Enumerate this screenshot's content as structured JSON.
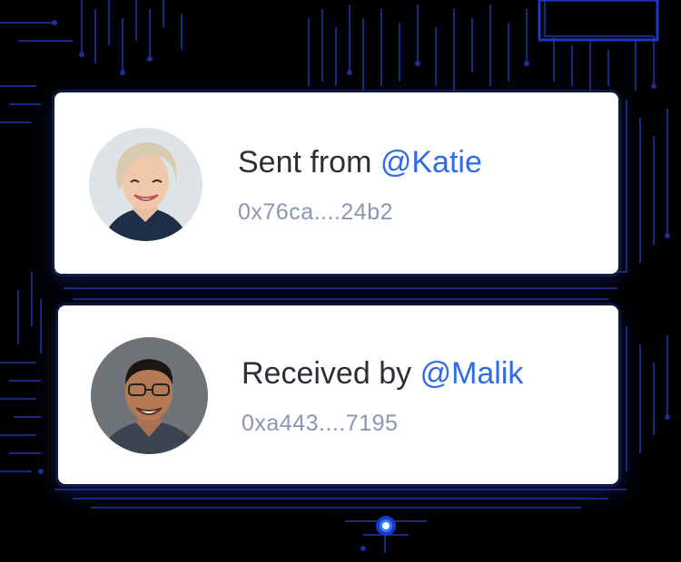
{
  "colors": {
    "accent": "#2f6be9",
    "text": "#2b2f36",
    "muted": "#8a96b4",
    "pattern": "#1d2f8f"
  },
  "transactions": [
    {
      "prefix": "Sent from",
      "handle": "@Katie",
      "address": "0x76ca....24b2",
      "avatar_icon": "woman-portrait"
    },
    {
      "prefix": "Received by",
      "handle": "@Malik",
      "address": "0xa443....7195",
      "avatar_icon": "man-portrait"
    }
  ]
}
